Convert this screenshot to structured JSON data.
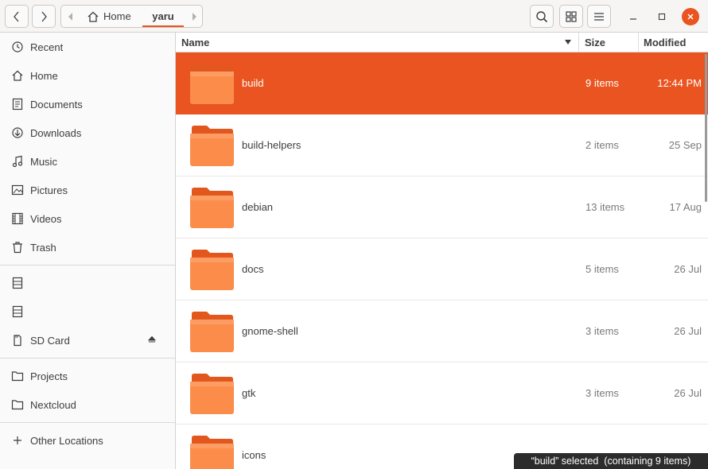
{
  "window": {
    "path": [
      "Home",
      "yaru"
    ],
    "accent_color": "#e95420"
  },
  "sidebar": {
    "items": [
      {
        "label": "Recent",
        "icon": "clock-icon"
      },
      {
        "label": "Home",
        "icon": "home-icon"
      },
      {
        "label": "Documents",
        "icon": "document-icon"
      },
      {
        "label": "Downloads",
        "icon": "download-icon"
      },
      {
        "label": "Music",
        "icon": "music-note-icon"
      },
      {
        "label": "Pictures",
        "icon": "picture-icon"
      },
      {
        "label": "Videos",
        "icon": "film-icon"
      },
      {
        "label": "Trash",
        "icon": "trash-icon"
      }
    ],
    "drives": [
      {
        "label": "",
        "icon": "drive-icon"
      },
      {
        "label": "",
        "icon": "drive-icon"
      },
      {
        "label": "SD Card",
        "icon": "sd-card-icon",
        "ejectable": true
      }
    ],
    "bookmarks": [
      {
        "label": "Projects",
        "icon": "folder-icon"
      },
      {
        "label": "Nextcloud",
        "icon": "folder-icon"
      }
    ],
    "other_locations": {
      "label": "Other Locations",
      "icon": "plus-icon"
    }
  },
  "columns": {
    "name": "Name",
    "size": "Size",
    "modified": "Modified"
  },
  "files": [
    {
      "name": "build",
      "size": "9 items",
      "modified": "12:44 PM",
      "selected": true
    },
    {
      "name": "build-helpers",
      "size": "2 items",
      "modified": "25 Sep"
    },
    {
      "name": "debian",
      "size": "13 items",
      "modified": "17 Aug"
    },
    {
      "name": "docs",
      "size": "5 items",
      "modified": "26 Jul"
    },
    {
      "name": "gnome-shell",
      "size": "3 items",
      "modified": "26 Jul"
    },
    {
      "name": "gtk",
      "size": "3 items",
      "modified": "26 Jul"
    },
    {
      "name": "icons",
      "size": "",
      "modified": ""
    }
  ],
  "status": {
    "text": "“build” selected  (containing 9 items)"
  }
}
